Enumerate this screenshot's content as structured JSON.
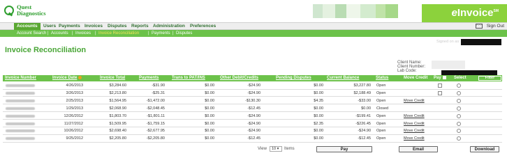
{
  "logo": {
    "line1": "Quest",
    "line2": "Diagnostics"
  },
  "brand": {
    "prefix": "e",
    "name": "Invoice",
    "tm": "SM",
    "accent": "#8cd23c"
  },
  "nav": {
    "items": [
      "Accounts",
      "Users",
      "Payments",
      "Invoices",
      "Disputes",
      "Reports",
      "Administration",
      "Preferences"
    ],
    "active": "Accounts",
    "help_icon": "help-icon",
    "sign_out": "Sign Out"
  },
  "subnav": {
    "items": [
      "Account Search",
      "Accounts",
      "Invoices",
      "Invoice Reconciliation",
      "Payments",
      "Disputes"
    ],
    "active": "Invoice Reconciliation"
  },
  "page": {
    "title": "Invoice Reconciliation",
    "signed_on": "Signed on as:"
  },
  "client": {
    "name_label": "Client Name:",
    "number_label": "Client Number:",
    "lab_label": "Lab Code:"
  },
  "table": {
    "headers": [
      "Invoice Number",
      "Invoice Date",
      "Invoice Total",
      "Payments",
      "Trans to PAT/INS",
      "Other Debit/Credits",
      "Pending Disputes",
      "Current Balance",
      "Status",
      "Move Credit",
      "Pay",
      "Select"
    ],
    "filter_label": "Filter",
    "rows": [
      {
        "date": "4/26/2013",
        "total": "$3,284.60",
        "payments": "-$31.90",
        "trans": "$0.00",
        "other": "-$24.90",
        "pending": "$0.00",
        "balance": "$3,227.80",
        "status": "Open",
        "move": "",
        "pay": true
      },
      {
        "date": "3/26/2013",
        "total": "$2,213.80",
        "payments": "-$25.31",
        "trans": "$0.00",
        "other": "-$24.90",
        "pending": "$0.00",
        "balance": "$2,188.49",
        "status": "Open",
        "move": "",
        "pay": true
      },
      {
        "date": "2/25/2013",
        "total": "$1,564.95",
        "payments": "-$1,472.00",
        "trans": "$0.00",
        "other": "-$130.30",
        "pending": "$4.35",
        "balance": "-$33.00",
        "status": "Open",
        "move": "Move Credit",
        "pay": false
      },
      {
        "date": "1/29/2013",
        "total": "$2,068.90",
        "payments": "-$2,048.45",
        "trans": "$0.00",
        "other": "-$12.45",
        "pending": "$0.00",
        "balance": "$0.00",
        "status": "Closed",
        "move": "",
        "pay": false
      },
      {
        "date": "12/26/2012",
        "total": "$1,803.70",
        "payments": "-$1,801.11",
        "trans": "$0.00",
        "other": "-$24.90",
        "pending": "$0.00",
        "balance": "-$199.41",
        "status": "Open",
        "move": "Move Credit",
        "pay": false
      },
      {
        "date": "11/27/2012",
        "total": "$1,509.95",
        "payments": "-$1,759.15",
        "trans": "$0.00",
        "other": "-$24.90",
        "pending": "$2.35",
        "balance": "-$226.45",
        "status": "Open",
        "move": "Move Credit",
        "pay": false
      },
      {
        "date": "10/26/2012",
        "total": "$2,698.40",
        "payments": "-$2,677.95",
        "trans": "$0.00",
        "other": "-$24.90",
        "pending": "$0.00",
        "balance": "-$24.90",
        "status": "Open",
        "move": "Move Credit",
        "pay": false
      },
      {
        "date": "9/25/2012",
        "total": "$2,205.80",
        "payments": "-$2,205.80",
        "trans": "$0.00",
        "other": "-$12.45",
        "pending": "$0.00",
        "balance": "-$12.45",
        "status": "Open",
        "move": "Move Credit",
        "pay": false
      }
    ]
  },
  "footer": {
    "view_label": "View",
    "view_value": "10",
    "items_label": "Items",
    "pay_button": "Pay",
    "email_button": "Email",
    "download_button": "Download"
  },
  "colors": {
    "header_green": "#6cc24a",
    "nav_active": "#5aa832",
    "title_green": "#49a636"
  }
}
